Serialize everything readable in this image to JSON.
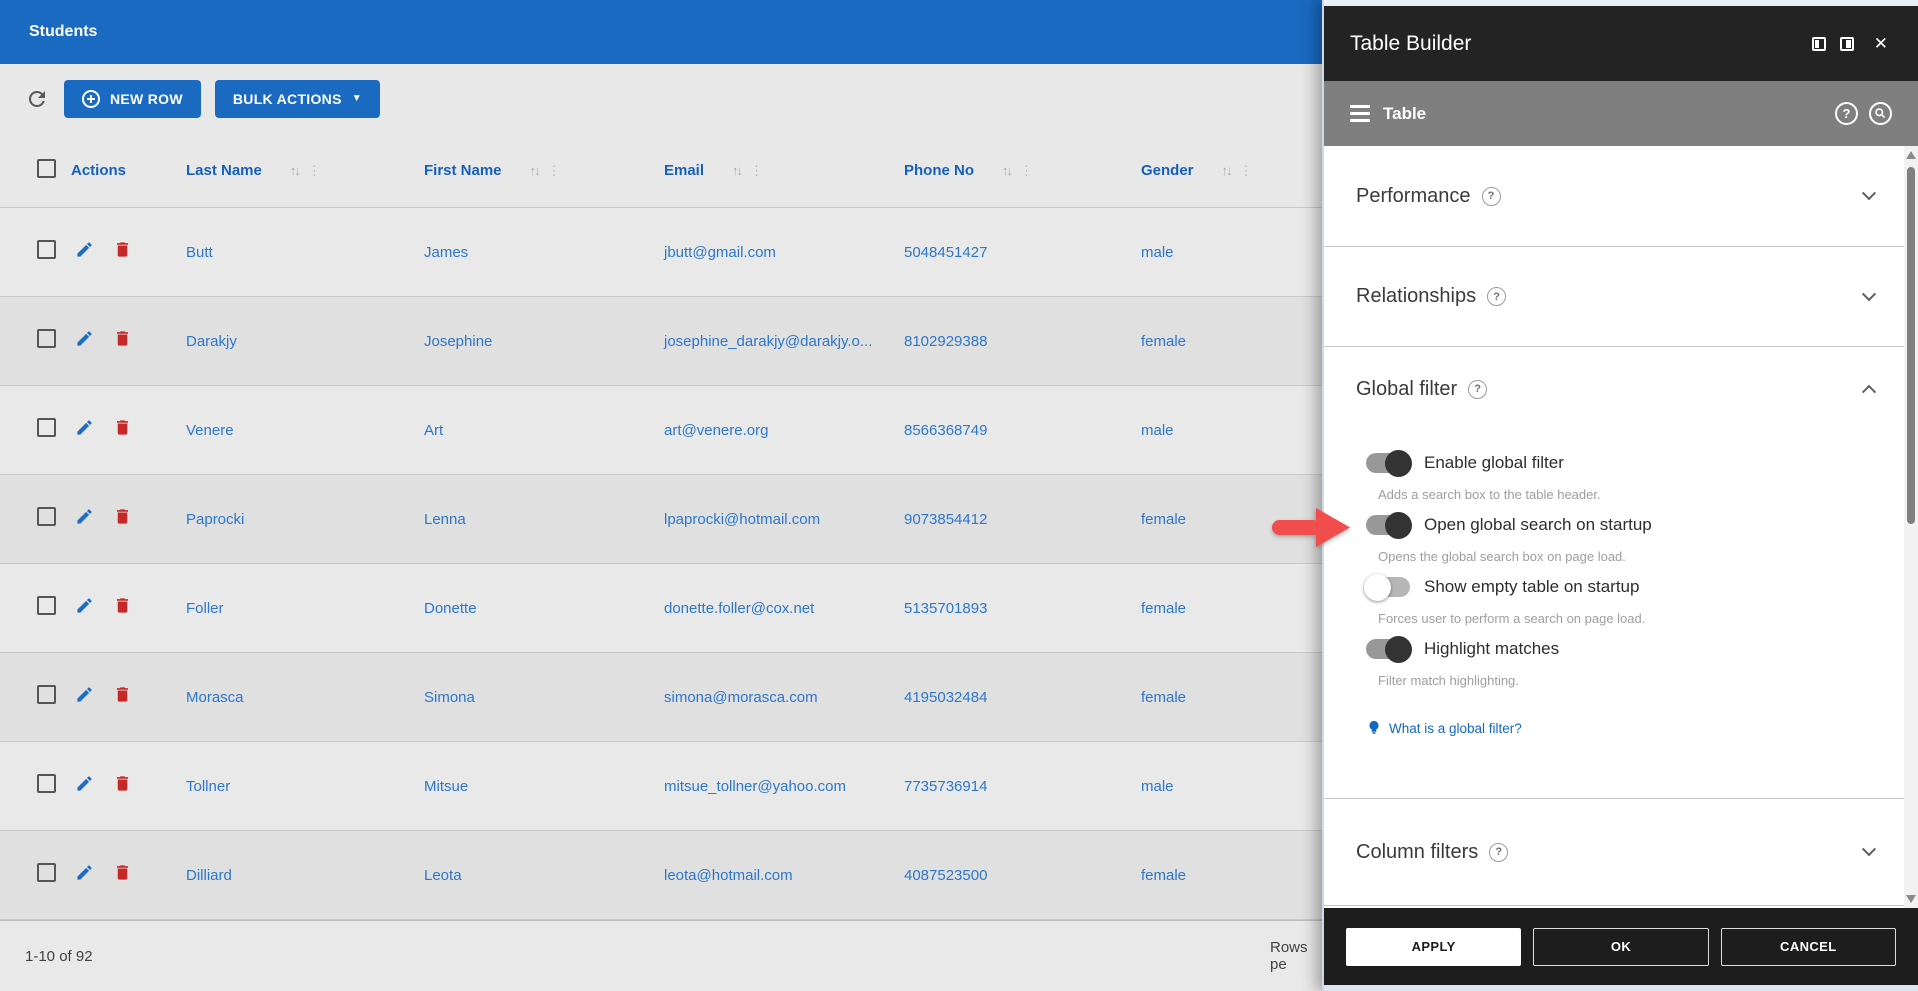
{
  "table": {
    "title": "Students",
    "toolbar": {
      "new_row_label": "NEW ROW",
      "bulk_actions_label": "BULK ACTIONS"
    },
    "columns": {
      "actions": "Actions",
      "last_name": "Last Name",
      "first_name": "First Name",
      "email": "Email",
      "phone": "Phone No",
      "gender": "Gender"
    },
    "rows": [
      {
        "last": "Butt",
        "first": "James",
        "email": "jbutt@gmail.com",
        "phone": "5048451427",
        "gender": "male"
      },
      {
        "last": "Darakjy",
        "first": "Josephine",
        "email": "josephine_darakjy@darakjy.o...",
        "phone": "8102929388",
        "gender": "female"
      },
      {
        "last": "Venere",
        "first": "Art",
        "email": "art@venere.org",
        "phone": "8566368749",
        "gender": "male"
      },
      {
        "last": "Paprocki",
        "first": "Lenna",
        "email": "lpaprocki@hotmail.com",
        "phone": "9073854412",
        "gender": "female"
      },
      {
        "last": "Foller",
        "first": "Donette",
        "email": "donette.foller@cox.net",
        "phone": "5135701893",
        "gender": "female"
      },
      {
        "last": "Morasca",
        "first": "Simona",
        "email": "simona@morasca.com",
        "phone": "4195032484",
        "gender": "female"
      },
      {
        "last": "Tollner",
        "first": "Mitsue",
        "email": "mitsue_tollner@yahoo.com",
        "phone": "7735736914",
        "gender": "male"
      },
      {
        "last": "Dilliard",
        "first": "Leota",
        "email": "leota@hotmail.com",
        "phone": "4087523500",
        "gender": "female"
      }
    ],
    "footer": {
      "range": "1-10 of 92",
      "rows_per_page_clipped": "Rows pe"
    }
  },
  "panel": {
    "title": "Table Builder",
    "tab_label": "Table",
    "sections": {
      "performance": "Performance",
      "relationships": "Relationships",
      "global_filter": "Global filter",
      "column_filters": "Column filters"
    },
    "global_filter": {
      "toggles": [
        {
          "label": "Enable global filter",
          "desc": "Adds a search box to the table header.",
          "on": true
        },
        {
          "label": "Open global search on startup",
          "desc": "Opens the global search box on page load.",
          "on": true
        },
        {
          "label": "Show empty table on startup",
          "desc": "Forces user to perform a search on page load.",
          "on": false
        },
        {
          "label": "Highlight matches",
          "desc": "Filter match highlighting.",
          "on": true
        }
      ],
      "help_link": "What is a global filter?"
    },
    "buttons": {
      "apply": "APPLY",
      "ok": "OK",
      "cancel": "CANCEL"
    }
  },
  "icons": {
    "sort_arrows": "↑↓",
    "kebab": "⋮",
    "dropdown": "▼",
    "close": "✕",
    "help": "?"
  },
  "colors": {
    "accent_blue": "#1a6ac2",
    "header_text_blue": "#1660bd",
    "cell_text_blue": "#2d77c9",
    "delete_red": "#c62828",
    "arrow_red": "#f14d4d",
    "panel_dark": "#232323",
    "tab_gray": "#7f7f7f"
  }
}
